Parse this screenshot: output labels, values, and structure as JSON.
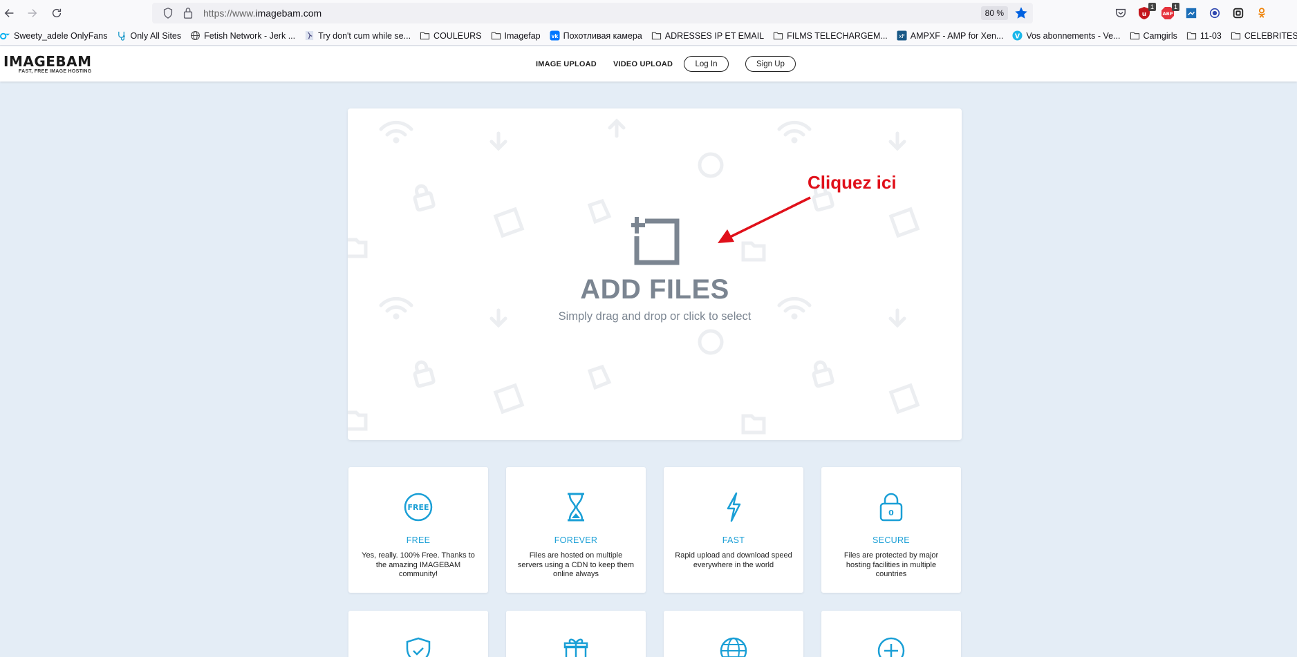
{
  "browser": {
    "url_prefix": "https://www.",
    "url_host": "imagebam.com",
    "zoom": "80 %",
    "extension_badges": [
      "1",
      "1"
    ],
    "bookmarks": [
      {
        "label": "Sweety_adele OnlyFans",
        "icon": "onlyfans-icon"
      },
      {
        "label": "Only All Sites",
        "icon": "stethoscope-icon"
      },
      {
        "label": "Fetish Network - Jerk ...",
        "icon": "globe-icon"
      },
      {
        "label": "Try don't cum while se...",
        "icon": "figure-icon"
      },
      {
        "label": "COULEURS",
        "icon": "folder-icon"
      },
      {
        "label": "Imagefap",
        "icon": "folder-icon"
      },
      {
        "label": "Похотливая камера",
        "icon": "vk-icon"
      },
      {
        "label": "ADRESSES IP ET EMAIL",
        "icon": "folder-icon"
      },
      {
        "label": "FILMS TELECHARGEM...",
        "icon": "folder-icon"
      },
      {
        "label": "AMPXF - AMP for Xen...",
        "icon": "xf-icon"
      },
      {
        "label": "Vos abonnements - Ve...",
        "icon": "v-icon"
      },
      {
        "label": "Camgirls",
        "icon": "folder-icon"
      },
      {
        "label": "11-03",
        "icon": "folder-icon"
      },
      {
        "label": "CELEBRITES",
        "icon": "folder-icon"
      }
    ]
  },
  "site": {
    "logo": "IMAGEBAM",
    "tagline": "FAST, FREE IMAGE HOSTING",
    "nav": {
      "image_upload": "IMAGE UPLOAD",
      "video_upload": "VIDEO UPLOAD",
      "login": "Log In",
      "signup": "Sign Up"
    }
  },
  "upload": {
    "title": "ADD FILES",
    "subtitle": "Simply drag and drop or click to select"
  },
  "annotation": {
    "text": "Cliquez ici",
    "color": "#e0101a"
  },
  "features": [
    {
      "title": "FREE",
      "icon": "free-badge-icon",
      "icon_text": "FREE",
      "desc": "Yes, really. 100% Free. Thanks to the amazing IMAGEBAM community!"
    },
    {
      "title": "FOREVER",
      "icon": "hourglass-icon",
      "desc": "Files are hosted on multiple servers using a CDN to keep them online always"
    },
    {
      "title": "FAST",
      "icon": "lightning-icon",
      "desc": "Rapid upload and download speed everywhere in the world"
    },
    {
      "title": "SECURE",
      "icon": "padlock-icon",
      "icon_text": "0",
      "desc": "Files are protected by major hosting facilities in multiple countries"
    }
  ],
  "features_row2_icons": [
    "shield-check-icon",
    "gift-box-icon",
    "globe-icon",
    "plus-circle-icon"
  ],
  "colors": {
    "accent": "#1a9fd6",
    "page_bg": "#e4edf6",
    "upload_text": "#7b8591"
  }
}
